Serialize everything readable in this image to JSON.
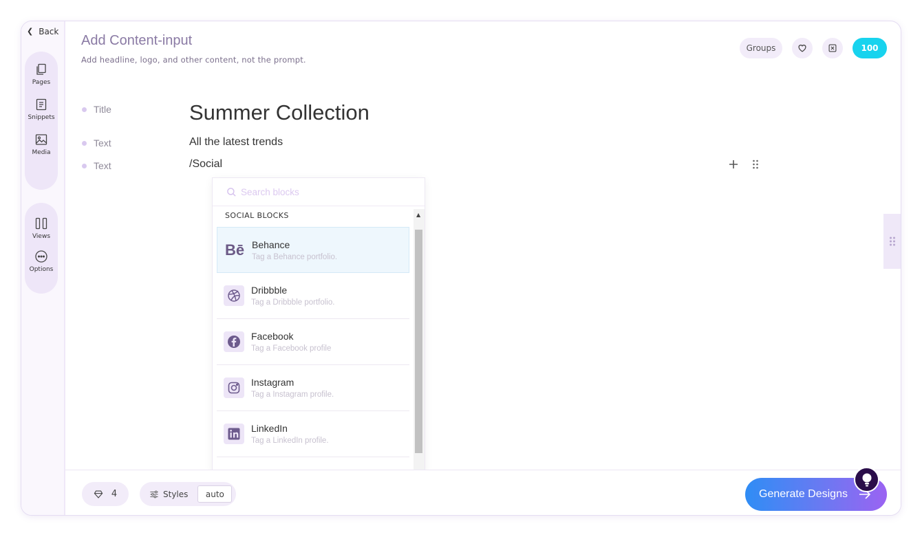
{
  "nav": {
    "back_label": "Back",
    "top_group": [
      {
        "label": "Pages",
        "icon": "pages-icon"
      },
      {
        "label": "Snippets",
        "icon": "snippets-icon"
      },
      {
        "label": "Media",
        "icon": "media-icon"
      }
    ],
    "bottom_group": [
      {
        "label": "Views",
        "icon": "views-icon"
      },
      {
        "label": "Options",
        "icon": "options-icon"
      }
    ]
  },
  "header": {
    "title": "Add Content-input",
    "subtitle": "Add headline, logo, and other content, not the prompt.",
    "groups_label": "Groups",
    "credits": "100"
  },
  "rows": [
    {
      "label": "Title",
      "value": "Summer Collection"
    },
    {
      "label": "Text",
      "value": "All the latest trends"
    },
    {
      "label": "Text",
      "value": "/Social"
    }
  ],
  "dropdown": {
    "search_placeholder": "Search blocks",
    "section_title": "SOCIAL BLOCKS",
    "items": [
      {
        "name": "Behance",
        "desc": "Tag a Behance portfolio.",
        "icon": "behance-icon",
        "active": true
      },
      {
        "name": "Dribbble",
        "desc": "Tag a Dribbble portfolio.",
        "icon": "dribbble-icon"
      },
      {
        "name": "Facebook",
        "desc": "Tag a Facebook profile",
        "icon": "facebook-icon"
      },
      {
        "name": "Instagram",
        "desc": "Tag a Instagram profile.",
        "icon": "instagram-icon"
      },
      {
        "name": "LinkedIn",
        "desc": "Tag a LinkedIn profile.",
        "icon": "linkedin-icon"
      }
    ]
  },
  "footer": {
    "gem_count": "4",
    "styles_label": "Styles",
    "styles_value": "auto",
    "generate_label": "Generate Designs"
  },
  "colors": {
    "accent_cyan": "#18d3ee",
    "rail_pill": "#eee6f8",
    "gradient_start": "#2f8df5",
    "gradient_end": "#9b63f2"
  }
}
